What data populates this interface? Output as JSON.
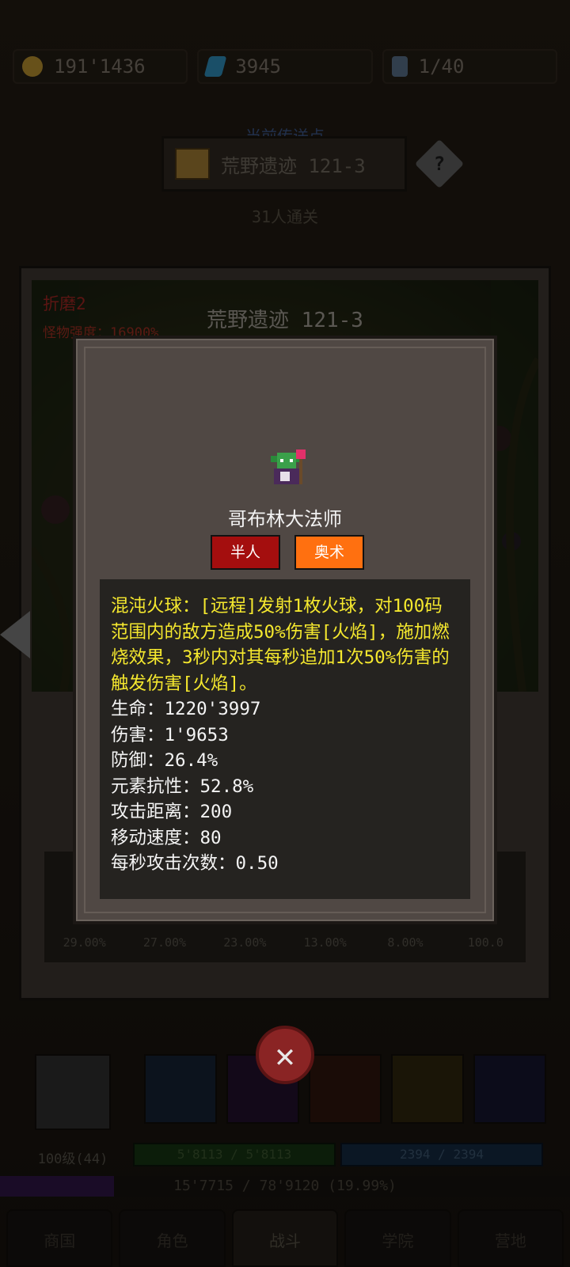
{
  "currency": {
    "gold": "191'1436",
    "gems": "3945",
    "keys": "1/40"
  },
  "portal": {
    "label": "当前传送点",
    "name": "荒野遗迹 121-3",
    "help": "?",
    "clear_count": "31人通关"
  },
  "stage": {
    "torment": "折磨2",
    "monster_strength": "怪物强度：16900%",
    "title": "荒野遗迹 121-3"
  },
  "drop_rates": [
    "29.00%",
    "27.00%",
    "23.00%",
    "13.00%",
    "8.00%",
    "100.0"
  ],
  "popup": {
    "monster_name": "哥布林大法师",
    "tags": [
      "半人",
      "奥术"
    ],
    "skill_description": "混沌火球：[远程]发射1枚火球，对100码范围内的敌方造成50%伤害[火焰]，施加燃烧效果，3秒内对其每秒追加1次50%伤害的触发伤害[火焰]。",
    "stats": [
      "生命：1220'3997",
      "伤害：1'9653",
      "防御：26.4%",
      "元素抗性：52.8%",
      "攻击距离：200",
      "移动速度：80",
      "每秒攻击次数：0.50"
    ]
  },
  "close_button": "✕",
  "player": {
    "level": "100级(44)",
    "hp": "5'8113 / 5'8113",
    "mp": "2394 / 2394",
    "xp": "15'7715 / 78'9120 (19.99%)"
  },
  "nav": [
    "商国",
    "角色",
    "战斗",
    "学院",
    "营地"
  ],
  "colors": {
    "race_tag": "#a40e0e",
    "element_tag": "#ff7010",
    "skill_text": "#f5e82e"
  }
}
